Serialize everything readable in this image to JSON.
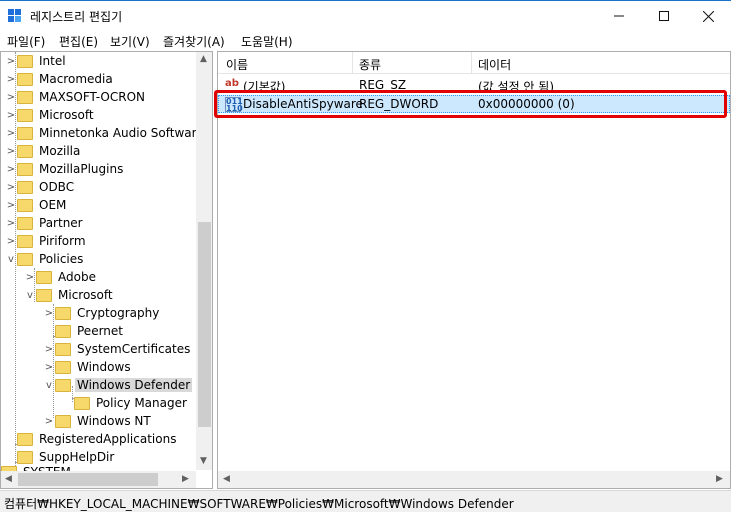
{
  "window": {
    "title": "레지스트리 편집기"
  },
  "menu": {
    "items": [
      "파일(F)",
      "편집(E)",
      "보기(V)",
      "즐겨찾기(A)",
      "도움말(H)"
    ]
  },
  "tree": {
    "items": [
      {
        "label": "Intel"
      },
      {
        "label": "Macromedia"
      },
      {
        "label": "MAXSOFT-OCRON"
      },
      {
        "label": "Microsoft"
      },
      {
        "label": "Minnetonka Audio Software"
      },
      {
        "label": "Mozilla"
      },
      {
        "label": "MozillaPlugins"
      },
      {
        "label": "ODBC"
      },
      {
        "label": "OEM"
      },
      {
        "label": "Partner"
      },
      {
        "label": "Piriform"
      },
      {
        "label": "Policies"
      },
      {
        "label": "Adobe"
      },
      {
        "label": "Microsoft"
      },
      {
        "label": "Cryptography"
      },
      {
        "label": "Peernet"
      },
      {
        "label": "SystemCertificates"
      },
      {
        "label": "Windows"
      },
      {
        "label": "Windows Defender"
      },
      {
        "label": "Policy Manager"
      },
      {
        "label": "Windows NT"
      },
      {
        "label": "RegisteredApplications"
      },
      {
        "label": "SuppHelpDir"
      },
      {
        "label": "SYSTEM"
      }
    ]
  },
  "list": {
    "columns": [
      "이름",
      "종류",
      "데이터"
    ],
    "rows": [
      {
        "name": "(기본값)",
        "type": "REG_SZ",
        "data": "(값 설정 안 됨)",
        "icon": "string-value-icon"
      },
      {
        "name": "DisableAntiSpyware",
        "type": "REG_DWORD",
        "data": "0x00000000 (0)",
        "icon": "binary-value-icon"
      }
    ]
  },
  "status": {
    "path": "컴퓨터₩HKEY_LOCAL_MACHINE₩SOFTWARE₩Policies₩Microsoft₩Windows Defender"
  },
  "colors": {
    "highlight": "#e00000",
    "selection": "#cce8ff",
    "folder": "#f7d86b",
    "titlebar_border": "#1a73c8"
  }
}
